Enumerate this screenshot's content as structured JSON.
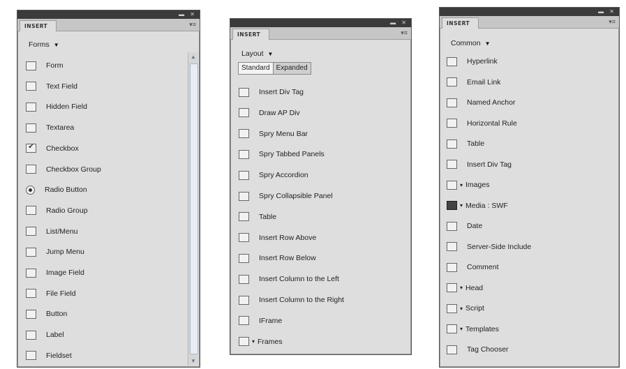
{
  "panels": [
    {
      "tab": "INSERT",
      "category": "Forms",
      "items": [
        {
          "label": "Form",
          "icon": "form-icon"
        },
        {
          "label": "Text Field",
          "icon": "text-field-icon"
        },
        {
          "label": "Hidden Field",
          "icon": "hidden-field-icon"
        },
        {
          "label": "Textarea",
          "icon": "textarea-icon"
        },
        {
          "label": "Checkbox",
          "icon": "checkbox-icon"
        },
        {
          "label": "Checkbox Group",
          "icon": "checkbox-group-icon"
        },
        {
          "label": "Radio Button",
          "icon": "radio-button-icon"
        },
        {
          "label": "Radio Group",
          "icon": "radio-group-icon"
        },
        {
          "label": "List/Menu",
          "icon": "list-menu-icon"
        },
        {
          "label": "Jump Menu",
          "icon": "jump-menu-icon"
        },
        {
          "label": "Image Field",
          "icon": "image-field-icon"
        },
        {
          "label": "File Field",
          "icon": "file-field-icon"
        },
        {
          "label": "Button",
          "icon": "button-icon"
        },
        {
          "label": "Label",
          "icon": "label-icon"
        },
        {
          "label": "Fieldset",
          "icon": "fieldset-icon"
        }
      ]
    },
    {
      "tab": "INSERT",
      "category": "Layout",
      "modes": {
        "standard": "Standard",
        "expanded": "Expanded",
        "selected": "Standard"
      },
      "items": [
        {
          "label": "Insert Div Tag",
          "icon": "div-tag-icon"
        },
        {
          "label": "Draw AP Div",
          "icon": "ap-div-icon"
        },
        {
          "label": "Spry Menu Bar",
          "icon": "spry-menu-bar-icon"
        },
        {
          "label": "Spry Tabbed Panels",
          "icon": "spry-tabbed-panels-icon"
        },
        {
          "label": "Spry Accordion",
          "icon": "spry-accordion-icon"
        },
        {
          "label": "Spry Collapsible Panel",
          "icon": "spry-collapsible-panel-icon"
        },
        {
          "label": "Table",
          "icon": "table-icon"
        },
        {
          "label": "Insert Row Above",
          "icon": "row-above-icon"
        },
        {
          "label": "Insert Row Below",
          "icon": "row-below-icon"
        },
        {
          "label": "Insert Column to the Left",
          "icon": "column-left-icon"
        },
        {
          "label": "Insert Column to the Right",
          "icon": "column-right-icon"
        },
        {
          "label": "IFrame",
          "icon": "iframe-icon"
        },
        {
          "label": "Frames",
          "icon": "frames-icon"
        }
      ]
    },
    {
      "tab": "INSERT",
      "category": "Common",
      "items": [
        {
          "label": "Hyperlink",
          "icon": "hyperlink-icon"
        },
        {
          "label": "Email Link",
          "icon": "email-link-icon"
        },
        {
          "label": "Named Anchor",
          "icon": "named-anchor-icon"
        },
        {
          "label": "Horizontal Rule",
          "icon": "horizontal-rule-icon"
        },
        {
          "label": "Table",
          "icon": "table-icon"
        },
        {
          "label": "Insert Div Tag",
          "icon": "div-tag-icon"
        },
        {
          "label": "Images",
          "icon": "images-icon"
        },
        {
          "label": "Media : SWF",
          "icon": "media-swf-icon"
        },
        {
          "label": "Date",
          "icon": "date-icon"
        },
        {
          "label": "Server-Side Include",
          "icon": "server-side-include-icon"
        },
        {
          "label": "Comment",
          "icon": "comment-icon"
        },
        {
          "label": "Head",
          "icon": "head-icon"
        },
        {
          "label": "Script",
          "icon": "script-icon"
        },
        {
          "label": "Templates",
          "icon": "templates-icon"
        },
        {
          "label": "Tag Chooser",
          "icon": "tag-chooser-icon"
        }
      ]
    }
  ]
}
